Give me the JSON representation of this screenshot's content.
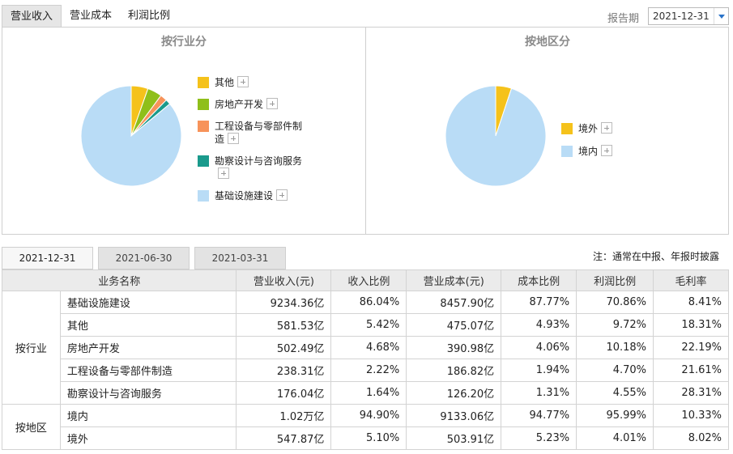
{
  "top_tabs": [
    {
      "label": "营业收入",
      "active": true
    },
    {
      "label": "营业成本",
      "active": false
    },
    {
      "label": "利润比例",
      "active": false
    }
  ],
  "report_period": {
    "label": "报告期",
    "value": "2021-12-31"
  },
  "chart_data": [
    {
      "type": "pie",
      "title": "按行业分",
      "slices": [
        {
          "label": "其他",
          "value": 5.42,
          "color": "#f5c21b"
        },
        {
          "label": "房地产开发",
          "value": 4.68,
          "color": "#8fbf1a"
        },
        {
          "label": "工程设备与零部件制造",
          "value": 2.22,
          "color": "#f7935a"
        },
        {
          "label": "勘察设计与咨询服务",
          "value": 1.64,
          "color": "#1a9a8c"
        },
        {
          "label": "基础设施建设",
          "value": 86.04,
          "color": "#b9dcf6"
        }
      ],
      "legend_position": "right"
    },
    {
      "type": "pie",
      "title": "按地区分",
      "slices": [
        {
          "label": "境外",
          "value": 5.1,
          "color": "#f5c21b"
        },
        {
          "label": "境内",
          "value": 94.9,
          "color": "#b9dcf6"
        }
      ],
      "legend_position": "right"
    }
  ],
  "period_tabs": [
    {
      "label": "2021-12-31",
      "active": true
    },
    {
      "label": "2021-06-30",
      "active": false
    },
    {
      "label": "2021-03-31",
      "active": false
    }
  ],
  "note": "注：通常在中报、年报时披露",
  "table": {
    "headers": [
      "业务名称",
      "营业收入(元)",
      "收入比例",
      "营业成本(元)",
      "成本比例",
      "利润比例",
      "毛利率"
    ],
    "groups": [
      {
        "name": "按行业",
        "rows": [
          [
            "基础设施建设",
            "9234.36亿",
            "86.04%",
            "8457.90亿",
            "87.77%",
            "70.86%",
            "8.41%"
          ],
          [
            "其他",
            "581.53亿",
            "5.42%",
            "475.07亿",
            "4.93%",
            "9.72%",
            "18.31%"
          ],
          [
            "房地产开发",
            "502.49亿",
            "4.68%",
            "390.98亿",
            "4.06%",
            "10.18%",
            "22.19%"
          ],
          [
            "工程设备与零部件制造",
            "238.31亿",
            "2.22%",
            "186.82亿",
            "1.94%",
            "4.70%",
            "21.61%"
          ],
          [
            "勘察设计与咨询服务",
            "176.04亿",
            "1.64%",
            "126.20亿",
            "1.31%",
            "4.55%",
            "28.31%"
          ]
        ]
      },
      {
        "name": "按地区",
        "rows": [
          [
            "境内",
            "1.02万亿",
            "94.90%",
            "9133.06亿",
            "94.77%",
            "95.99%",
            "10.33%"
          ],
          [
            "境外",
            "547.87亿",
            "5.10%",
            "503.91亿",
            "5.23%",
            "4.01%",
            "8.02%"
          ]
        ]
      }
    ]
  }
}
